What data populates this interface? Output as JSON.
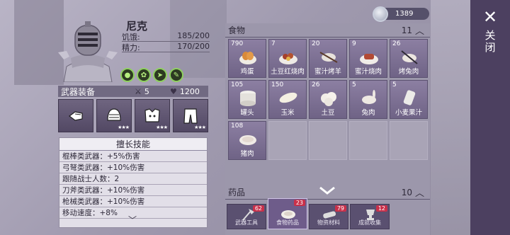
{
  "currency": {
    "icon": "coin-icon",
    "value": "1389"
  },
  "close": {
    "label": "关闭",
    "icon": "close-x-icon"
  },
  "character": {
    "name": "尼克",
    "stats": [
      {
        "label": "饥饿:",
        "value": "185/200"
      },
      {
        "label": "精力:",
        "value": "170/200"
      }
    ],
    "buffs": [
      "stomach-buff-icon",
      "brain-buff-icon",
      "running-buff-icon",
      "syringe-buff-icon"
    ]
  },
  "weapons": {
    "title": "武器装备",
    "attack": "5",
    "health": "1200",
    "slots": [
      {
        "icon": "fist-icon",
        "stars": ""
      },
      {
        "icon": "helmet-icon",
        "stars": "★★★"
      },
      {
        "icon": "armor-vest-icon",
        "stars": "★★★"
      },
      {
        "icon": "pants-icon",
        "stars": "★★★"
      }
    ]
  },
  "skills": {
    "title": "擅长技能",
    "rows": [
      "棍棒类武器：+5%伤害",
      "弓弩类武器：+10%伤害",
      "跟随战士人数：2",
      "刀斧类武器：+10%伤害",
      "枪械类武器：+10%伤害",
      "移动速度：+8%"
    ]
  },
  "food": {
    "title": "食物",
    "count": "11",
    "items": [
      {
        "qty": "790",
        "name": "鸡蛋",
        "icon": "egg-icon"
      },
      {
        "qty": "7",
        "name": "土豆红烧肉",
        "icon": "stew-icon"
      },
      {
        "qty": "20",
        "name": "蜜汁烤羊",
        "icon": "roast-lamb-icon"
      },
      {
        "qty": "9",
        "name": "蜜汁烧肉",
        "icon": "roast-meat-icon"
      },
      {
        "qty": "26",
        "name": "烤兔肉",
        "icon": "roast-rabbit-icon"
      },
      {
        "qty": "105",
        "name": "罐头",
        "icon": "can-icon"
      },
      {
        "qty": "150",
        "name": "玉米",
        "icon": "corn-icon"
      },
      {
        "qty": "26",
        "name": "土豆",
        "icon": "potato-icon"
      },
      {
        "qty": "5",
        "name": "兔肉",
        "icon": "rabbit-icon"
      },
      {
        "qty": "5",
        "name": "小麦果汁",
        "icon": "juice-can-icon"
      },
      {
        "qty": "108",
        "name": "猪肉",
        "icon": "pork-icon"
      }
    ]
  },
  "medicine": {
    "title": "药品",
    "count": "10"
  },
  "tabs": [
    {
      "label": "武器工具",
      "badge": "62",
      "icon": "axe-icon",
      "active": false
    },
    {
      "label": "食物药品",
      "badge": "23",
      "icon": "food-icon",
      "active": true
    },
    {
      "label": "物资材料",
      "badge": "79",
      "icon": "wood-icon",
      "active": false
    },
    {
      "label": "成就收集",
      "badge": "12",
      "icon": "trophy-icon",
      "active": false
    }
  ],
  "colors": {
    "accent": "#6e5c8a",
    "badge": "#c9304a",
    "buff": "#8fd060"
  }
}
